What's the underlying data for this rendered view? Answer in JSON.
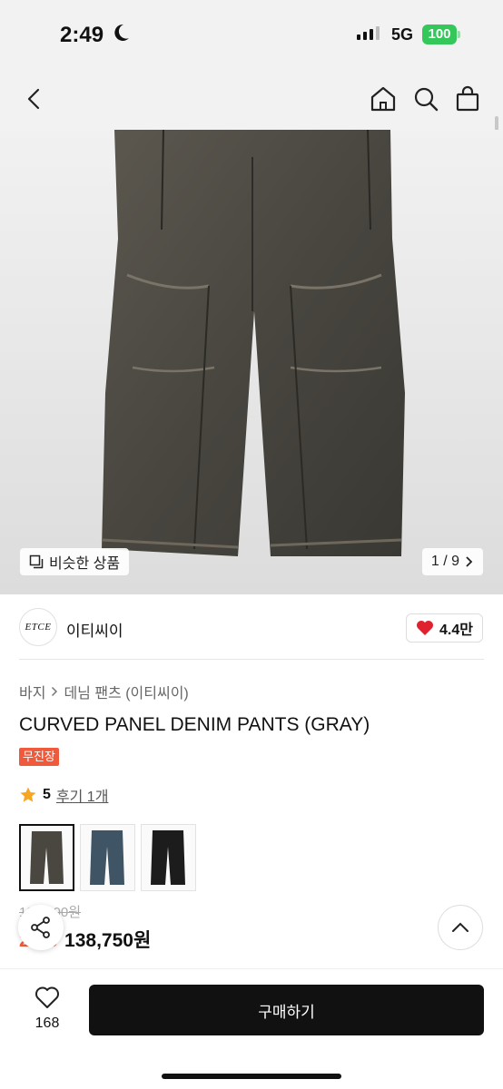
{
  "status_bar": {
    "time": "2:49",
    "network": "5G",
    "battery": "100"
  },
  "header": {
    "icons": [
      "back-icon",
      "home-icon",
      "search-icon",
      "shopping-bag-icon"
    ]
  },
  "gallery": {
    "similar_label": "비슷한 상품",
    "pager": "1 / 9"
  },
  "brand": {
    "logo_text": "ETCE",
    "name": "이티씨이",
    "likes": "4.4만"
  },
  "breadcrumb": {
    "category": "바지",
    "subcategory": "데님 팬츠 (이티씨이)"
  },
  "product": {
    "title": "CURVED PANEL DENIM PANTS (GRAY)",
    "badge": "무진장",
    "rating": "5",
    "reviews": "후기 1개",
    "original_price": "185,000원",
    "discount": "25%",
    "sale_price": "138,750원"
  },
  "variants": [
    {
      "name": "gray",
      "color": "#4a4740",
      "selected": true
    },
    {
      "name": "blue",
      "color": "#3f5566",
      "selected": false
    },
    {
      "name": "black",
      "color": "#1c1c1c",
      "selected": false
    }
  ],
  "bottom_bar": {
    "wish_count": "168",
    "buy_label": "구매하기"
  },
  "colors": {
    "accent": "#f05a3c",
    "heart": "#e0212e",
    "star": "#f5a623",
    "buy": "#111111"
  }
}
